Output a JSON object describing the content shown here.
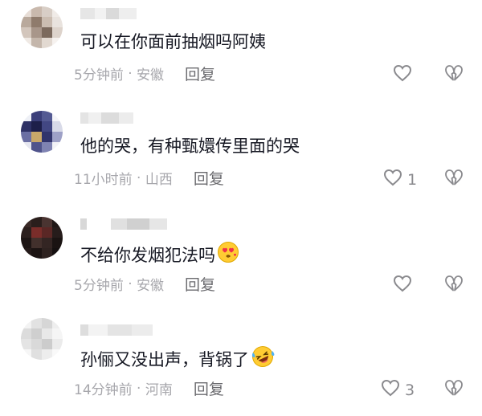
{
  "comments": [
    {
      "text": "可以在你面前抽烟吗阿姨",
      "emoji": "",
      "time": "5分钟前",
      "location": "安徽",
      "reply_label": "回复",
      "like_count": ""
    },
    {
      "text": "他的哭，有种甄嬛传里面的哭",
      "emoji": "",
      "time": "11小时前",
      "location": "山西",
      "reply_label": "回复",
      "like_count": "1"
    },
    {
      "text": "不给你发烟犯法吗",
      "emoji": "heart-eyes-kiss-emoji",
      "time": "5分钟前",
      "location": "安徽",
      "reply_label": "回复",
      "like_count": ""
    },
    {
      "text": "孙俪又没出声，背锅了",
      "emoji": "rolling-laughing-emoji",
      "time": "14分钟前",
      "location": "河南",
      "reply_label": "回复",
      "like_count": "3"
    }
  ],
  "colors": {
    "text": "#161823",
    "meta": "#a7a7ac",
    "reply": "#6b6b6f",
    "icon": "#8a8a8e"
  },
  "icons": {
    "like": "heart-outline-icon",
    "dislike": "broken-heart-icon"
  }
}
